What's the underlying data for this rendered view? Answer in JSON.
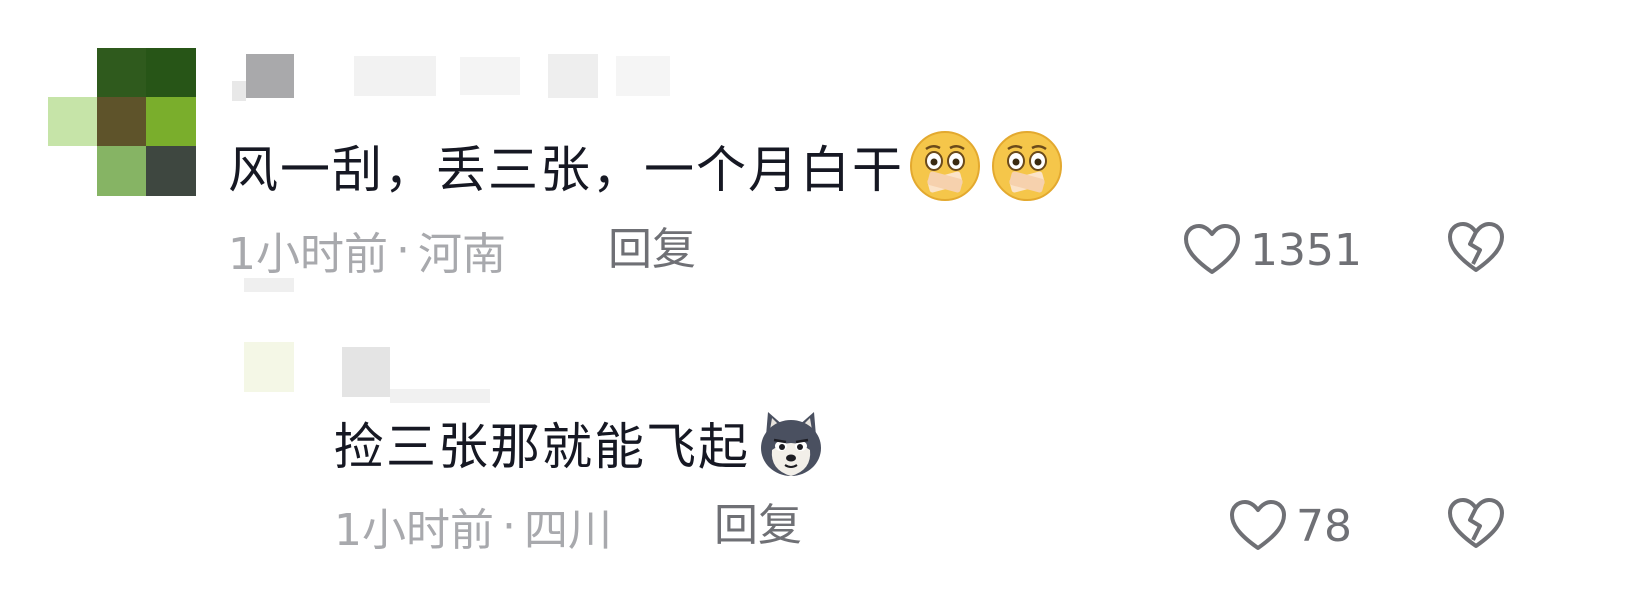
{
  "comments": [
    {
      "text": "风一刮，丢三张，一个月白干",
      "emoji_name": "shocked-face-emoji",
      "time": "1小时前",
      "separator": "·",
      "location": "河南",
      "reply_label": "回复",
      "like_count": "1351"
    },
    {
      "text": "捡三张那就能飞起",
      "emoji_name": "husky-dog-emoji",
      "time": "1小时前",
      "separator": "·",
      "location": "四川",
      "reply_label": "回复",
      "like_count": "78"
    }
  ],
  "colors": {
    "text": "#161823",
    "meta": "#a8a9ad",
    "action": "#6f7075"
  }
}
